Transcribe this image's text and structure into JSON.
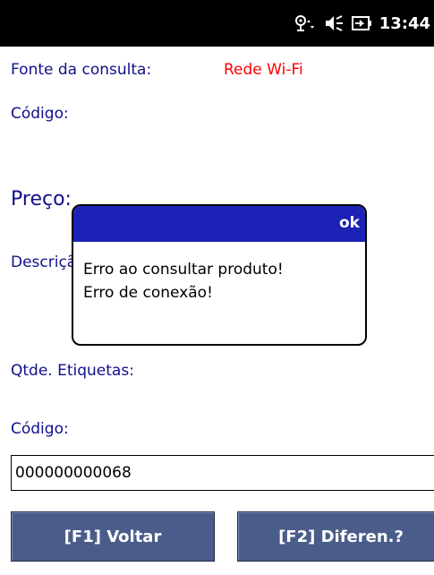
{
  "status_bar": {
    "time": "13:44",
    "icons": [
      "network-icon",
      "volume-icon",
      "battery-charging-icon"
    ]
  },
  "form": {
    "source_label": "Fonte da consulta:",
    "source_value": "Rede Wi-Fi",
    "code_label": "Código:",
    "price_label": "Preço:",
    "description_label": "Descrição:",
    "labels_qty_label": "Qtde. Etiquetas:",
    "code_input_label": "Código:",
    "code_input_value": "000000000068"
  },
  "dialog": {
    "ok_label": "ok",
    "message_line1": "Erro ao consultar produto!",
    "message_line2": "Erro de conexão!"
  },
  "buttons": {
    "back_label": "[F1] Voltar",
    "diff_label": "[F2] Diferen.?"
  },
  "colors": {
    "label_color": "#10108a",
    "source_value_color": "#ff0000",
    "dialog_title_bg": "#1c22b6",
    "button_bg": "#4a5d8a"
  }
}
